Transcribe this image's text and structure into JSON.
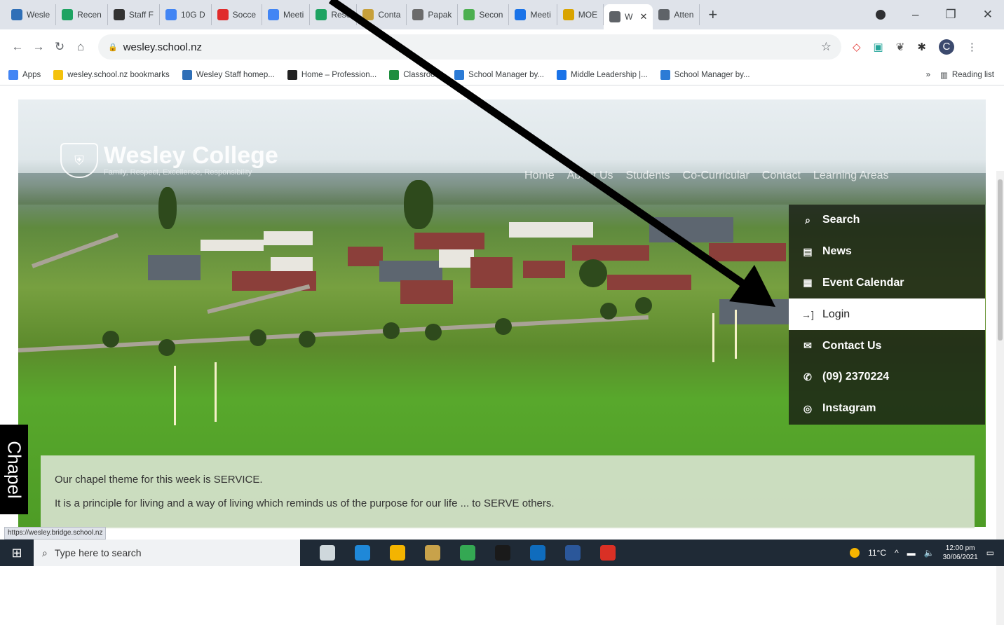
{
  "tabs": [
    {
      "label": "Wesle",
      "color": "#2f6fb7"
    },
    {
      "label": "Recen",
      "color": "#1ea362"
    },
    {
      "label": "Staff F",
      "color": "#333333"
    },
    {
      "label": "10G D",
      "color": "#4285f4"
    },
    {
      "label": "Socce",
      "color": "#e02c2c"
    },
    {
      "label": "Meeti",
      "color": "#4285f4"
    },
    {
      "label": "Rese",
      "color": "#1ea362"
    },
    {
      "label": "Conta",
      "color": "#c7a03a"
    },
    {
      "label": "Papak",
      "color": "#6b6b6b"
    },
    {
      "label": "Secon",
      "color": "#4caf50"
    },
    {
      "label": "Meeti",
      "color": "#1a73e8"
    },
    {
      "label": "MOE",
      "color": "#d9a400"
    },
    {
      "label": "W",
      "color": "#5f6368",
      "active": true
    },
    {
      "label": "Atten",
      "color": "#5f6368"
    }
  ],
  "window": {
    "new_tab": "+",
    "minimize": "–",
    "restore": "❐",
    "close": "✕"
  },
  "address": {
    "url": "wesley.school.nz"
  },
  "profile_initial": "C",
  "bookmarks": [
    {
      "label": "Apps",
      "color": "#4285f4"
    },
    {
      "label": "wesley.school.nz bookmarks",
      "color": "#f4c20d"
    },
    {
      "label": "Wesley Staff homep...",
      "color": "#2f6fb7"
    },
    {
      "label": "Home – Profession...",
      "color": "#222222"
    },
    {
      "label": "Classroom",
      "color": "#1e8e3e"
    },
    {
      "label": "School Manager by...",
      "color": "#2b7bd6"
    },
    {
      "label": "Middle Leadership |...",
      "color": "#1a73e8"
    },
    {
      "label": "School Manager by...",
      "color": "#2b7bd6"
    }
  ],
  "bookmarks_more": "»",
  "reading_list": "Reading list",
  "site": {
    "name": "Wesley College",
    "tagline": "Family, Respect, Excellence, Responsibility",
    "nav": [
      "Home",
      "About Us",
      "Students",
      "Co-Curricular",
      "Contact",
      "Learning Areas"
    ],
    "menu": [
      {
        "label": "Search",
        "icon": "search-icon",
        "glyph": "⌕"
      },
      {
        "label": "News",
        "icon": "news-icon",
        "glyph": "▤"
      },
      {
        "label": "Event Calendar",
        "icon": "calendar-icon",
        "glyph": "▦"
      },
      {
        "label": "Login",
        "icon": "login-icon",
        "glyph": "→]",
        "active": true
      },
      {
        "label": "Contact Us",
        "icon": "mail-icon",
        "glyph": "✉"
      },
      {
        "label": "(09) 2370224",
        "icon": "phone-icon",
        "glyph": "✆"
      },
      {
        "label": "Instagram",
        "icon": "instagram-icon",
        "glyph": "◎"
      }
    ],
    "chapel_tab": "Chapel",
    "chapel_line1": "Our chapel theme for this week is SERVICE.",
    "chapel_line2": "It is a principle for living and a way of living which reminds us of the purpose for our life ... to SERVE others."
  },
  "status_link": "https://wesley.bridge.school.nz",
  "taskbar": {
    "search_placeholder": "Type here to search",
    "weather": "11°C",
    "time": "12:00 pm",
    "date": "30/06/2021",
    "apps": [
      "#cfd8dc",
      "#1f88d8",
      "#f4b400",
      "#c8a24a",
      "#34a853",
      "#1a1a1a",
      "#0f6cbd",
      "#2b579a",
      "#d93025"
    ]
  }
}
